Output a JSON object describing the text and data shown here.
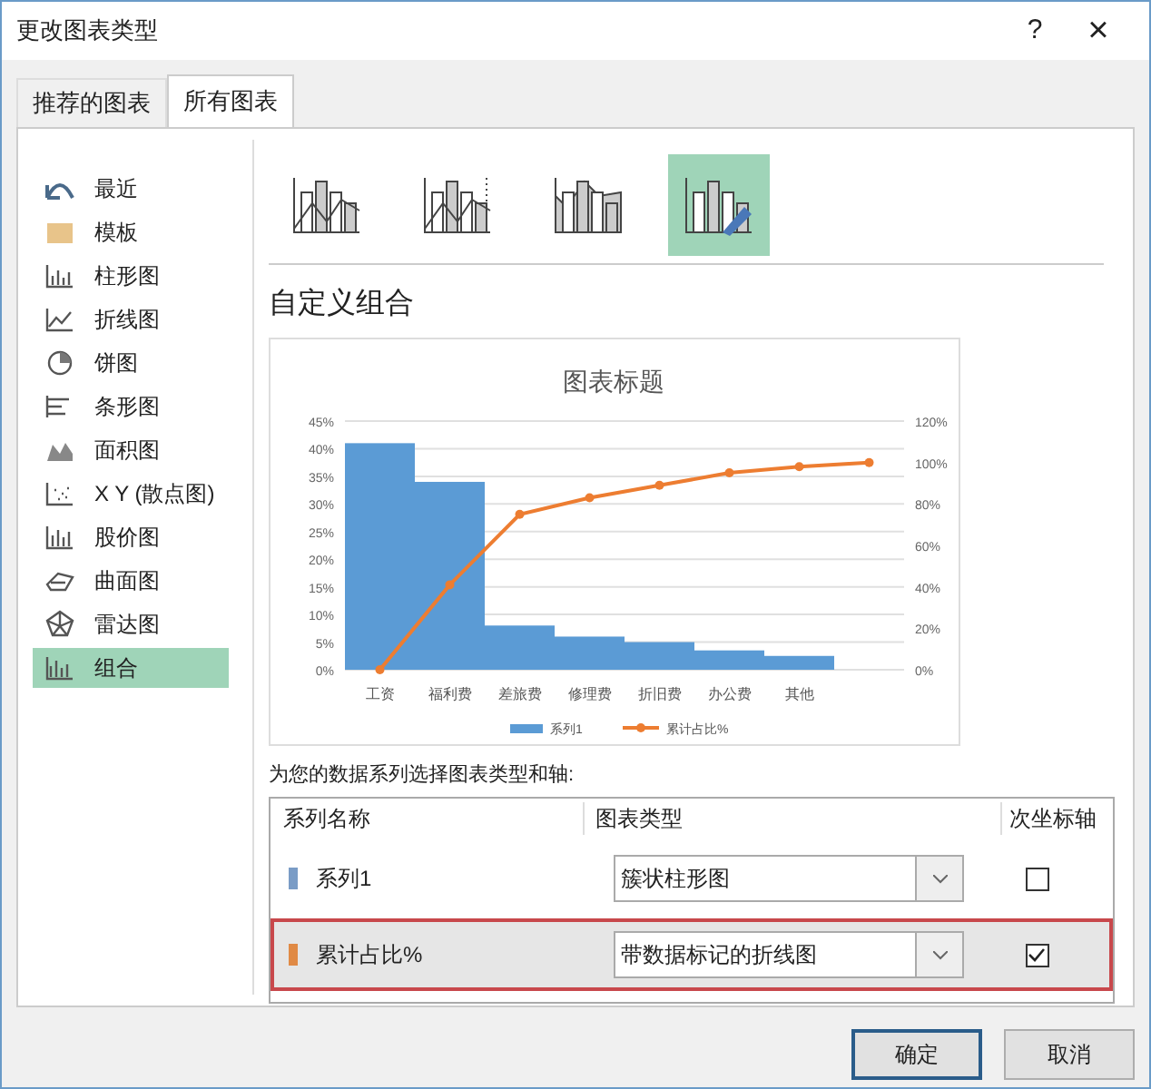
{
  "window": {
    "title": "更改图表类型",
    "help": "?",
    "close": "×"
  },
  "tabs": [
    {
      "label": "推荐的图表",
      "selected": false
    },
    {
      "label": "所有图表",
      "selected": true
    }
  ],
  "sidebar": {
    "items": [
      {
        "label": "最近",
        "selected": false
      },
      {
        "label": "模板",
        "selected": false
      },
      {
        "label": "柱形图",
        "selected": false
      },
      {
        "label": "折线图",
        "selected": false
      },
      {
        "label": "饼图",
        "selected": false
      },
      {
        "label": "条形图",
        "selected": false
      },
      {
        "label": "面积图",
        "selected": false
      },
      {
        "label": "X Y (散点图)",
        "selected": false
      },
      {
        "label": "股价图",
        "selected": false
      },
      {
        "label": "曲面图",
        "selected": false
      },
      {
        "label": "雷达图",
        "selected": false
      },
      {
        "label": "组合",
        "selected": true
      }
    ]
  },
  "chart_subtypes": [
    {
      "selected": false
    },
    {
      "selected": false
    },
    {
      "selected": false
    },
    {
      "selected": true
    }
  ],
  "section_title": "自定义组合",
  "preview": {
    "chart_data": {
      "type": "bar",
      "title": "图表标题",
      "categories": [
        "工资",
        "福利费",
        "差旅费",
        "修理费",
        "折旧费",
        "办公费",
        "其他",
        null
      ],
      "series": [
        {
          "name": "系列1",
          "color": "#5b9bd5",
          "values": [
            41,
            34,
            8,
            6,
            5,
            3.5,
            2.5,
            null
          ]
        },
        {
          "name": "累计占比%",
          "color": "#ed7d31",
          "type": "line",
          "axis": "y2",
          "marker": "circle",
          "values": [
            0,
            41,
            75,
            83,
            89,
            95,
            98,
            100
          ]
        }
      ],
      "ylim": [
        0,
        45
      ],
      "y2lim": [
        0,
        120
      ],
      "grid": true,
      "legend": "bottom",
      "yticks": [
        {
          "value": 0,
          "label": "0%"
        },
        {
          "value": 5,
          "label": "5%"
        },
        {
          "value": 10,
          "label": "10%"
        },
        {
          "value": 15,
          "label": "15%"
        },
        {
          "value": 20,
          "label": "20%"
        },
        {
          "value": 25,
          "label": "25%"
        },
        {
          "value": 30,
          "label": "30%"
        },
        {
          "value": 35,
          "label": "35%"
        },
        {
          "value": 40,
          "label": "40%"
        },
        {
          "value": 45,
          "label": "45%"
        }
      ],
      "y2ticks": [
        {
          "value": 0,
          "label": "0%"
        },
        {
          "value": 20,
          "label": "20%"
        },
        {
          "value": 40,
          "label": "40%"
        },
        {
          "value": 60,
          "label": "60%"
        },
        {
          "value": 80,
          "label": "80%"
        },
        {
          "value": 100,
          "label": "100%"
        },
        {
          "value": 120,
          "label": "120%"
        }
      ]
    }
  },
  "series_prompt": "为您的数据系列选择图表类型和轴:",
  "table": {
    "columns": [
      "系列名称",
      "图表类型",
      "次坐标轴"
    ],
    "rows": [
      {
        "name": "系列1",
        "color": "#7a9cc6",
        "chart_type": "簇状柱形图",
        "secondary_axis": false,
        "selected": false
      },
      {
        "name": "累计占比%",
        "color": "#e08a45",
        "chart_type": "带数据标记的折线图",
        "secondary_axis": true,
        "selected": true
      }
    ]
  },
  "buttons": [
    {
      "label": "确定",
      "default": true
    },
    {
      "label": "取消",
      "default": false
    }
  ]
}
